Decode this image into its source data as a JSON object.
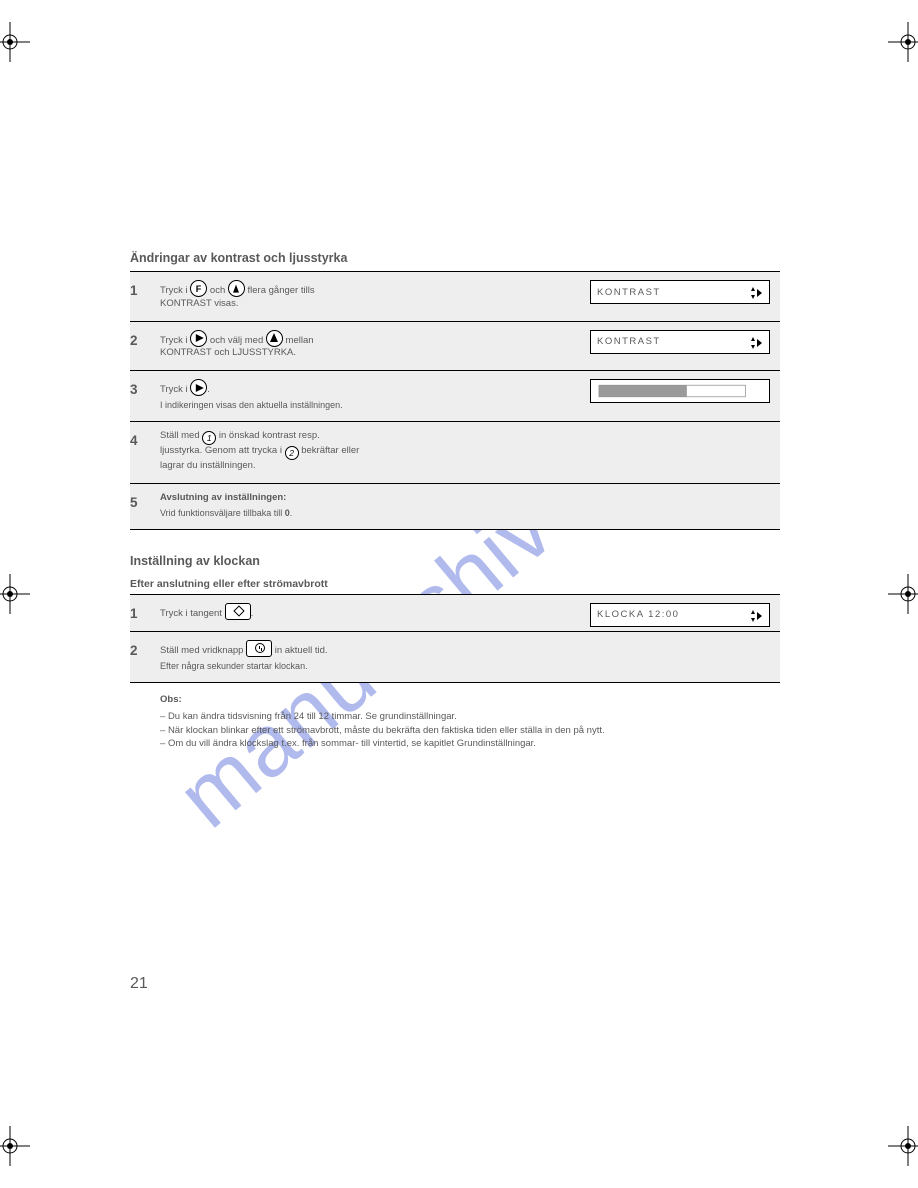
{
  "watermark": "manualshive.com",
  "heading_main": "Ändringar av kontrast och ljusstyrka",
  "rows": {
    "r1": {
      "num": "1",
      "line1_a": "Tryck i ",
      "line1_b": " och ",
      "line1_c": " flera gånger tills",
      "line2": "KONTRAST visas.",
      "display": "KONTRAST"
    },
    "r2": {
      "num": "2",
      "line1_a": "Tryck i ",
      "line1_b": " och välj med ",
      "line1_c": " mellan",
      "line2": "KONTRAST och LJUSSTYRKA.",
      "display": "KONTRAST"
    },
    "r3": {
      "num": "3",
      "line1_a": "Tryck i ",
      "line1_b": ".",
      "desc": "I indikeringen visas den aktuella inställningen.",
      "display": ""
    },
    "r4": {
      "num": "4",
      "line1_a": "Ställ med ",
      "line1_b": " in önskad kontrast resp.",
      "line2_a": "ljusstyrka. Genom att trycka i ",
      "line2_b": " bekräftar eller",
      "line3": "lagrar du inställningen."
    },
    "r5": {
      "num": "5",
      "title": "Avslutning av inställningen:",
      "desc_a": "Vrid funktionsväljare tillbaka till ",
      "desc_b": "."
    }
  },
  "heading_2": "Inställning av klockan",
  "sub_2": "Efter anslutning eller efter strömavbrott",
  "rows2": {
    "r1": {
      "num": "1",
      "line_a": "Tryck i tangent ",
      "line_b": ".",
      "display": "KLOCKA 12:00"
    },
    "r2": {
      "num": "2",
      "line_a": "Ställ med vridknapp ",
      "line_b": " in aktuell tid.",
      "desc": "Efter några sekunder startar klockan."
    }
  },
  "note_title": "Obs:",
  "note_items": [
    "Du kan ändra tidsvisning från 24 till 12 timmar. Se grundinställningar.",
    "När klockan blinkar efter ett strömavbrott, måste du bekräfta den faktiska tiden eller ställa in den på nytt.",
    "Om du vill ändra klockslag t.ex. från sommar- till vintertid, se kapitlet Grundinställningar."
  ],
  "page_number": "21"
}
